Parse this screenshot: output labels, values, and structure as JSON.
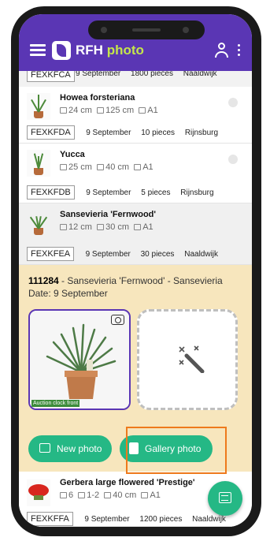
{
  "appbar": {
    "brand_main": "RFH",
    "brand_accent": "photo",
    "menu_icon": "hamburger-icon",
    "user_icon": "user-icon",
    "more_icon": "kebab-icon"
  },
  "list": {
    "partial_top": {
      "code": "FEXKFCA",
      "date": "9 September",
      "pieces": "1800 pieces",
      "location": "Naaldwijk"
    },
    "items": [
      {
        "name": "Howea forsteriana",
        "pot": "24 cm",
        "height": "125 cm",
        "quality": "A1",
        "code": "FEXKFDA",
        "date": "9 September",
        "pieces": "10 pieces",
        "location": "Rijnsburg"
      },
      {
        "name": "Yucca",
        "pot": "25 cm",
        "height": "40 cm",
        "quality": "A1",
        "code": "FEXKFDB",
        "date": "9 September",
        "pieces": "5 pieces",
        "location": "Rijnsburg"
      },
      {
        "name": "Sansevieria 'Fernwood'",
        "pot": "12 cm",
        "height": "30 cm",
        "quality": "A1",
        "code": "FEXKFEA",
        "date": "9 September",
        "pieces": "30 pieces",
        "location": "Naaldwijk"
      }
    ],
    "bottom_item": {
      "name": "Gerbera large flowered 'Prestige'",
      "stems": "6",
      "ripeness": "1-2",
      "height": "40 cm",
      "quality": "A1",
      "code": "FEXKFFA",
      "date": "9 September",
      "pieces": "1200 pieces",
      "location": "Naaldwijk"
    }
  },
  "detail": {
    "lot_number": "111284",
    "title_rest": " - Sansevieria 'Fernwood' - Sansevieria",
    "date_line": "Date: 9 September",
    "photo_label": "Auction clock front",
    "new_photo_label": "New photo",
    "gallery_photo_label": "Gallery photo"
  },
  "colors": {
    "appbar": "#5a36b4",
    "accent_green": "#25b885",
    "detail_bg": "#f7e6bd",
    "highlight": "#ee7a1c"
  }
}
